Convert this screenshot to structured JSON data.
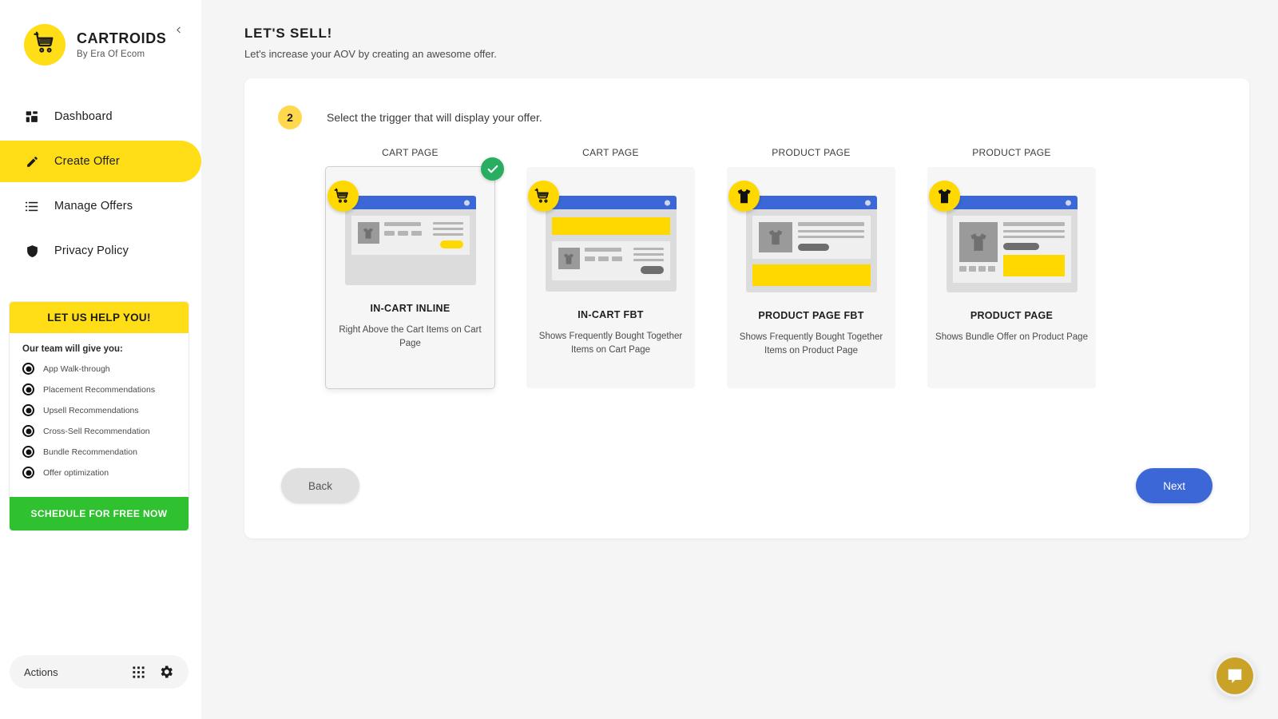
{
  "brand": {
    "title": "CARTROIDS",
    "subtitle": "By Era Of Ecom",
    "logo_icon": "shopping-cart-icon",
    "collapse_icon": "chevron-left-icon",
    "accent_yellow": "#ffde17"
  },
  "sidebar": {
    "items": [
      {
        "label": "Dashboard",
        "icon": "dashboard-grid-icon",
        "active": false
      },
      {
        "label": "Create Offer",
        "icon": "pencil-icon",
        "active": true
      },
      {
        "label": "Manage Offers",
        "icon": "list-icon",
        "active": false
      },
      {
        "label": "Privacy Policy",
        "icon": "shield-icon",
        "active": false
      }
    ],
    "help": {
      "heading": "LET US HELP YOU!",
      "subheading": "Our team will give you:",
      "items": [
        "App Walk-through",
        "Placement Recommendations",
        "Upsell Recommendations",
        "Cross-Sell Recommendation",
        "Bundle Recommendation",
        "Offer optimization"
      ],
      "cta": "SCHEDULE FOR FREE NOW",
      "cta_color": "#2fc12f"
    },
    "actions": {
      "label": "Actions",
      "grid_icon": "apps-grid-icon",
      "gear_icon": "gear-icon"
    }
  },
  "header": {
    "title": "LET'S SELL!",
    "subtitle": "Let's increase your AOV by creating an awesome offer."
  },
  "step": {
    "number": "2",
    "instruction": "Select the trigger that will display your offer."
  },
  "triggers": [
    {
      "page_label": "CART PAGE",
      "name": "IN-CART INLINE",
      "description": "Right Above the Cart Items on Cart Page",
      "badge_icon": "shopping-cart-icon",
      "selected": true,
      "selected_icon": "check-icon",
      "mockup": "in-cart-inline"
    },
    {
      "page_label": "CART PAGE",
      "name": "IN-CART FBT",
      "description": "Shows Frequently Bought Together Items on Cart Page",
      "badge_icon": "shopping-cart-icon",
      "selected": false,
      "mockup": "in-cart-fbt"
    },
    {
      "page_label": "PRODUCT PAGE",
      "name": "PRODUCT PAGE FBT",
      "description": "Shows Frequently Bought Together Items on Product Page",
      "badge_icon": "tshirt-icon",
      "selected": false,
      "mockup": "product-page-fbt"
    },
    {
      "page_label": "PRODUCT PAGE",
      "name": "PRODUCT PAGE",
      "description": "Shows Bundle Offer on Product Page",
      "badge_icon": "tshirt-icon",
      "selected": false,
      "mockup": "product-page-bundle"
    }
  ],
  "footer": {
    "back_label": "Back",
    "next_label": "Next",
    "next_color": "#3b68d6"
  },
  "chat": {
    "icon": "intercom-chat-icon",
    "color": "#c9a227"
  }
}
